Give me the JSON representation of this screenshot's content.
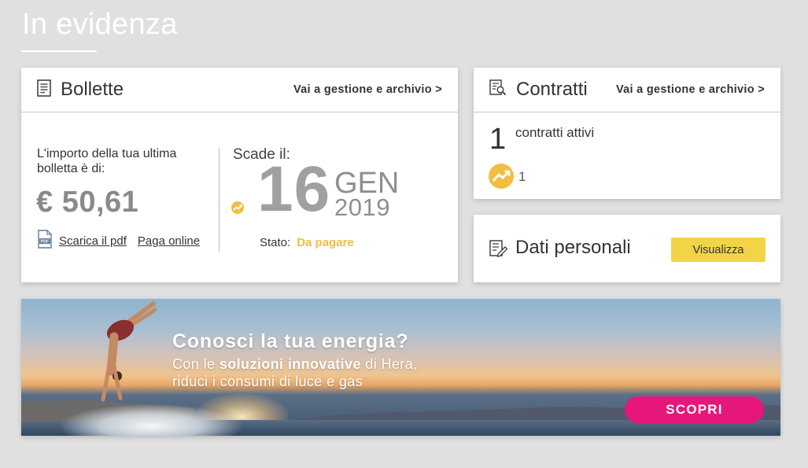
{
  "page": {
    "title": "In evidenza"
  },
  "bollette": {
    "title": "Bollette",
    "link": "Vai a gestione e archivio >",
    "intro": "L'importo della tua ultima bolletta è di:",
    "amount": "€ 50,61",
    "download_pdf": "Scarica il pdf",
    "pay_online": "Paga online",
    "due_label": "Scade il:",
    "due_day": "16",
    "due_month": "GEN",
    "due_year": "2019",
    "status_label": "Stato:",
    "status_value": "Da pagare",
    "status_color": "#f2bd42"
  },
  "contratti": {
    "title": "Contratti",
    "link": "Vai a gestione e archivio >",
    "count": "1",
    "count_label": "contratti attivi",
    "energy_count": "1"
  },
  "dati_personali": {
    "title": "Dati personali",
    "button": "Visualizza",
    "button_color": "#f2d447"
  },
  "banner": {
    "headline": "Conosci la tua energia?",
    "sub_prefix": "Con le",
    "sub_bold": "soluzioni innovative",
    "sub_suffix": "di Hera,",
    "sub_line2": "riduci i consumi di luce e gas",
    "cta": "SCOPRI",
    "cta_color": "#e6177a"
  },
  "icons": {
    "bollette": "document-icon",
    "contratti": "contract-search-icon",
    "dati": "edit-document-icon",
    "pdf": "pdf-file-icon",
    "energy": "energy-trend-icon"
  }
}
